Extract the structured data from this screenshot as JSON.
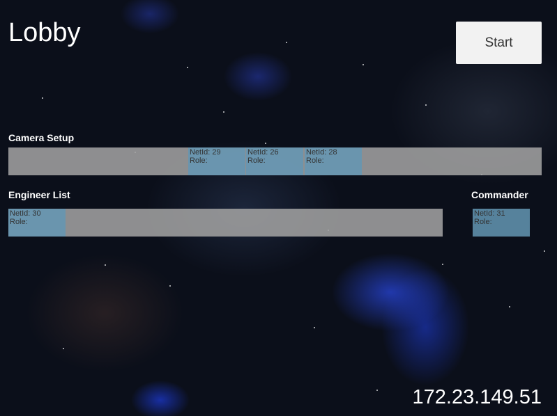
{
  "header": {
    "title": "Lobby",
    "start_label": "Start"
  },
  "camera_setup": {
    "label": "Camera Setup",
    "players": [
      {
        "netid": "NetId: 29",
        "role": "Role:"
      },
      {
        "netid": "NetId: 26",
        "role": "Role:"
      },
      {
        "netid": "NetId: 28",
        "role": "Role:"
      }
    ]
  },
  "engineer_list": {
    "label": "Engineer List",
    "players": [
      {
        "netid": "NetId: 30",
        "role": "Role:"
      }
    ]
  },
  "commander": {
    "label": "Commander",
    "players": [
      {
        "netid": "NetId: 31",
        "role": "Role:"
      }
    ]
  },
  "footer": {
    "ip_address": "172.23.149.51"
  }
}
